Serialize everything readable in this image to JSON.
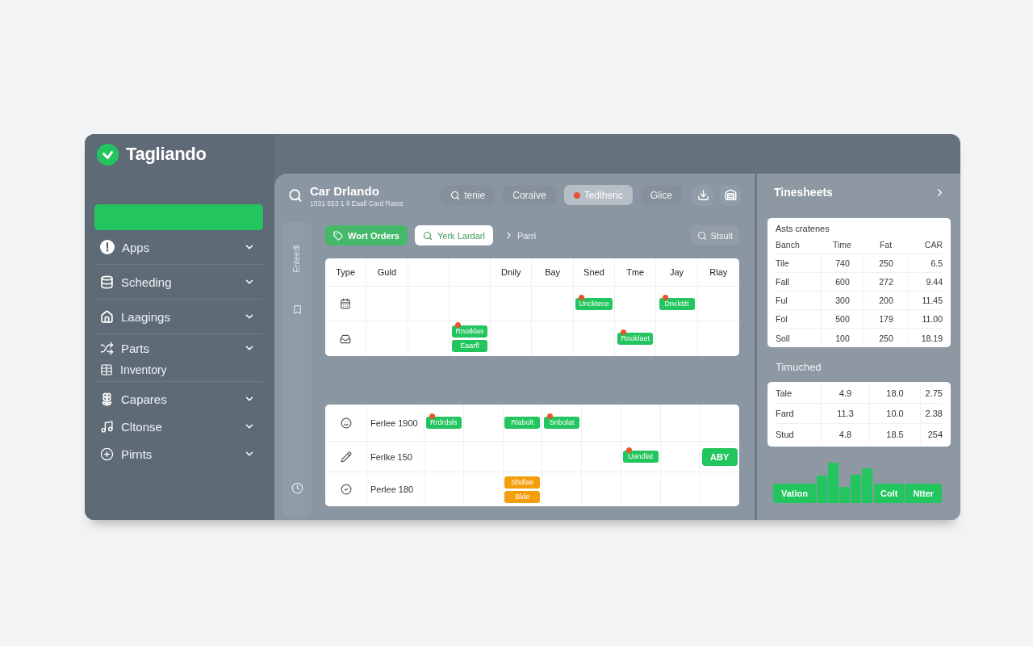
{
  "app": {
    "name": "Tagliando"
  },
  "sidebar": {
    "sections": [
      {
        "items": [
          {
            "label": "Apps"
          }
        ]
      },
      {
        "items": [
          {
            "label": "Scheding"
          }
        ]
      },
      {
        "items": [
          {
            "label": "Laagings"
          }
        ]
      },
      {
        "items": [
          {
            "label": "Parts",
            "children": [
              {
                "label": "Inventory"
              }
            ]
          }
        ]
      },
      {
        "items": [
          {
            "label": "Capares"
          },
          {
            "label": "Cltonse"
          },
          {
            "label": "Pirnts"
          }
        ]
      }
    ]
  },
  "header": {
    "title": "Car Drlando",
    "subtitle": "1031 553 1 Il Eaall Card Rams",
    "tabs": [
      {
        "label": "tenie",
        "kind": "search",
        "selected": false
      },
      {
        "label": "Coralve",
        "kind": "plain",
        "selected": false
      },
      {
        "label": "Tedlheric",
        "kind": "dot",
        "selected": true
      },
      {
        "label": "Glice",
        "kind": "plain",
        "selected": false
      }
    ]
  },
  "toolbar": {
    "side_label": "Enteedl",
    "filters": [
      {
        "label": "Wort Orders",
        "selected": true
      },
      {
        "label": "Yerk Lardarl",
        "selected": false
      }
    ],
    "breadcrumb": "Parri",
    "action": "Stsult"
  },
  "schedule": {
    "columns": [
      {
        "label": "Type"
      },
      {
        "label": "Guld"
      },
      {},
      {},
      {
        "label": "Dnily"
      },
      {
        "label": "Bay"
      },
      {
        "label": "Sned"
      },
      {
        "label": "Tme"
      },
      {
        "label": "Jay"
      },
      {
        "label": "Rlay"
      }
    ],
    "rows": [
      {
        "cells": [
          {},
          {},
          {},
          {},
          {},
          {},
          {
            "events": [
              {
                "label": "Uncktece",
                "color": "#22c55e",
                "alert": true
              }
            ]
          },
          {},
          {
            "events": [
              {
                "label": "Dncktitt",
                "color": "#22c55e",
                "alert": true
              }
            ]
          },
          {}
        ]
      },
      {
        "cells": [
          {},
          {},
          {},
          {
            "events": [
              {
                "label": "Rnotklas",
                "color": "#22c55e",
                "alert": true
              },
              {
                "label": "Eaarfl",
                "color": "#22c55e",
                "alert": false
              }
            ]
          },
          {},
          {},
          {},
          {
            "events": [
              {
                "label": "Rnoklaet",
                "color": "#22c55e",
                "alert": true
              }
            ]
          },
          {},
          {}
        ]
      }
    ]
  },
  "vehicles": {
    "rows": [
      {
        "name": "Ferlee 1900",
        "cells": [
          {
            "events": [
              {
                "label": "Rrdrdsls",
                "color": "#22c55e",
                "alert": true
              }
            ]
          },
          {},
          {
            "events": [
              {
                "label": "Rlabolt",
                "color": "#22c55e",
                "alert": false
              }
            ]
          },
          {
            "events": [
              {
                "label": "Snbolat",
                "color": "#22c55e",
                "alert": true
              }
            ]
          },
          {},
          {},
          {},
          {}
        ]
      },
      {
        "name": "Ferlke 150",
        "cells": [
          {},
          {},
          {},
          {},
          {},
          {
            "events": [
              {
                "label": "Uandlat",
                "color": "#22c55e",
                "alert": true
              }
            ]
          },
          {},
          {
            "button": "ABY"
          }
        ]
      },
      {
        "name": "Perlee 180",
        "cells": [
          {},
          {},
          {
            "events": [
              {
                "label": "Sbdlae",
                "color": "#f59e0b",
                "alert": false
              },
              {
                "label": "Blde",
                "color": "#f59e0b",
                "alert": false
              }
            ]
          },
          {},
          {},
          {},
          {},
          {}
        ]
      }
    ]
  },
  "timesheets": {
    "title": "Tinesheets",
    "card_title": "Asts cratenes",
    "columns": [
      "Banch",
      "Time",
      "Fat",
      "CAR"
    ],
    "rows": [
      [
        "Tile",
        "740",
        "250",
        "6.5"
      ],
      [
        "Fall",
        "600",
        "272",
        "9.44"
      ],
      [
        "Ful",
        "300",
        "200",
        "11.45"
      ],
      [
        "Fol",
        "500",
        "179",
        "11.00"
      ],
      [
        "Soll",
        "100",
        "250",
        "18.19"
      ]
    ]
  },
  "summary": {
    "title": "Timuched",
    "rows": [
      [
        "Tale",
        "4.9",
        "18.0",
        "2.75"
      ],
      [
        "Fard",
        "11.3",
        "10.0",
        "2.38"
      ],
      [
        "Stud",
        "4.8",
        "18.5",
        "254"
      ]
    ]
  },
  "footer": {
    "buttons": [
      "Vation",
      "Colt",
      "Ntter"
    ]
  }
}
